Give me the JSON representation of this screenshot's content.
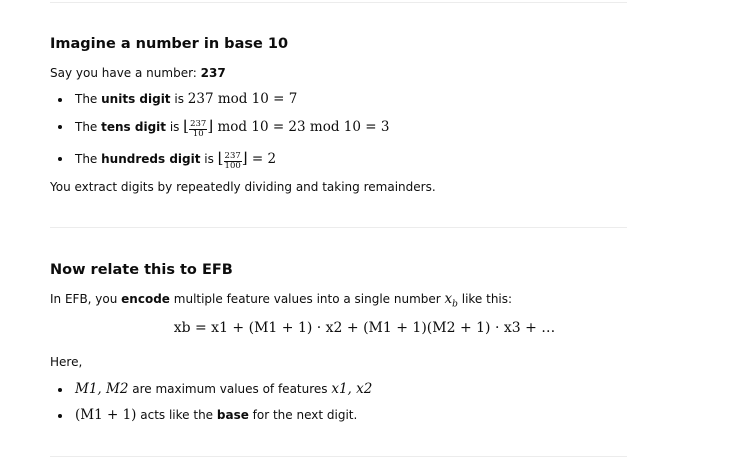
{
  "section1": {
    "heading": "Imagine a number in base 10",
    "intro_prefix": "Say you have a number: ",
    "intro_number": "237",
    "bullets": [
      {
        "pre": "The ",
        "bold": "units digit",
        "post": " is "
      },
      {
        "pre": "The ",
        "bold": "tens digit",
        "post": " is "
      },
      {
        "pre": "The ",
        "bold": "hundreds digit",
        "post": " is "
      }
    ],
    "math": {
      "units": "237  mod 10 = 7",
      "frac_237": "237",
      "frac_10": "10",
      "frac_100": "100",
      "tens_tail": " mod 10 = 23  mod 10 = 3",
      "hundreds_tail": " = 2"
    },
    "outro": "You extract digits by repeatedly dividing and taking remainders."
  },
  "section2": {
    "heading": "Now relate this to EFB",
    "intro_prefix": "In EFB, you ",
    "intro_bold": "encode",
    "intro_middle": " multiple feature values into a single number ",
    "intro_suffix": " like this:",
    "equation": "xb = x1 + (M1 + 1) · x2 + (M1 + 1)(M2 + 1) · x3 + …",
    "here": "Here,",
    "bullet1_math": "M1, M2",
    "bullet1_text": " are maximum values of features ",
    "bullet1_math2": "x1, x2",
    "bullet2_math": "(M1 + 1)",
    "bullet2_pre": " acts like the ",
    "bullet2_bold": "base",
    "bullet2_post": " for the next digit."
  }
}
